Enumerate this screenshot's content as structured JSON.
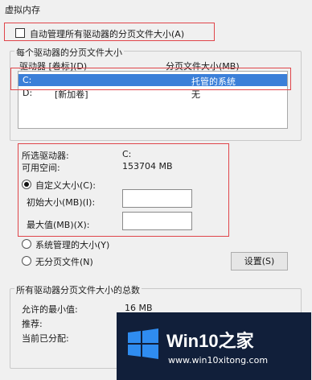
{
  "dialog": {
    "title": "虚拟内存"
  },
  "auto_manage": {
    "label": "自动管理所有驱动器的分页文件大小(A)",
    "checked": false
  },
  "per_drive": {
    "caption": "每个驱动器的分页文件大小",
    "col_drive": "驱动器 [卷标](D)",
    "col_size": "分页文件大小(MB)",
    "rows": [
      {
        "drive": "C:",
        "label": "",
        "size": "托管的系统",
        "selected": true
      },
      {
        "drive": "D:",
        "label": "[新加卷]",
        "size": "无",
        "selected": false
      }
    ]
  },
  "selected_drive": {
    "drive_label": "所选驱动器:",
    "drive_value": "C:",
    "space_label": "可用空间:",
    "space_value": "153704 MB"
  },
  "options": {
    "custom_label": "自定义大小(C):",
    "initial_label": "初始大小(MB)(I):",
    "initial_value": "",
    "max_label": "最大值(MB)(X):",
    "max_value": "",
    "system_label": "系统管理的大小(Y)",
    "none_label": "无分页文件(N)",
    "set_button": "设置(S)",
    "selected": "custom"
  },
  "totals": {
    "caption": "所有驱动器分页文件大小的总数",
    "min_label": "允许的最小值:",
    "min_value": "16 MB",
    "rec_label": "推荐:",
    "cur_label": "当前已分配:"
  },
  "watermark": {
    "brand_prefix": "Win10",
    "brand_suffix": "之家",
    "url": "www.win10xitong.com",
    "bg": "#111f3a",
    "accent": "#2f8cf0"
  },
  "colors": {
    "highlight_box": "#e0454a",
    "selection": "#3b7fd8"
  }
}
